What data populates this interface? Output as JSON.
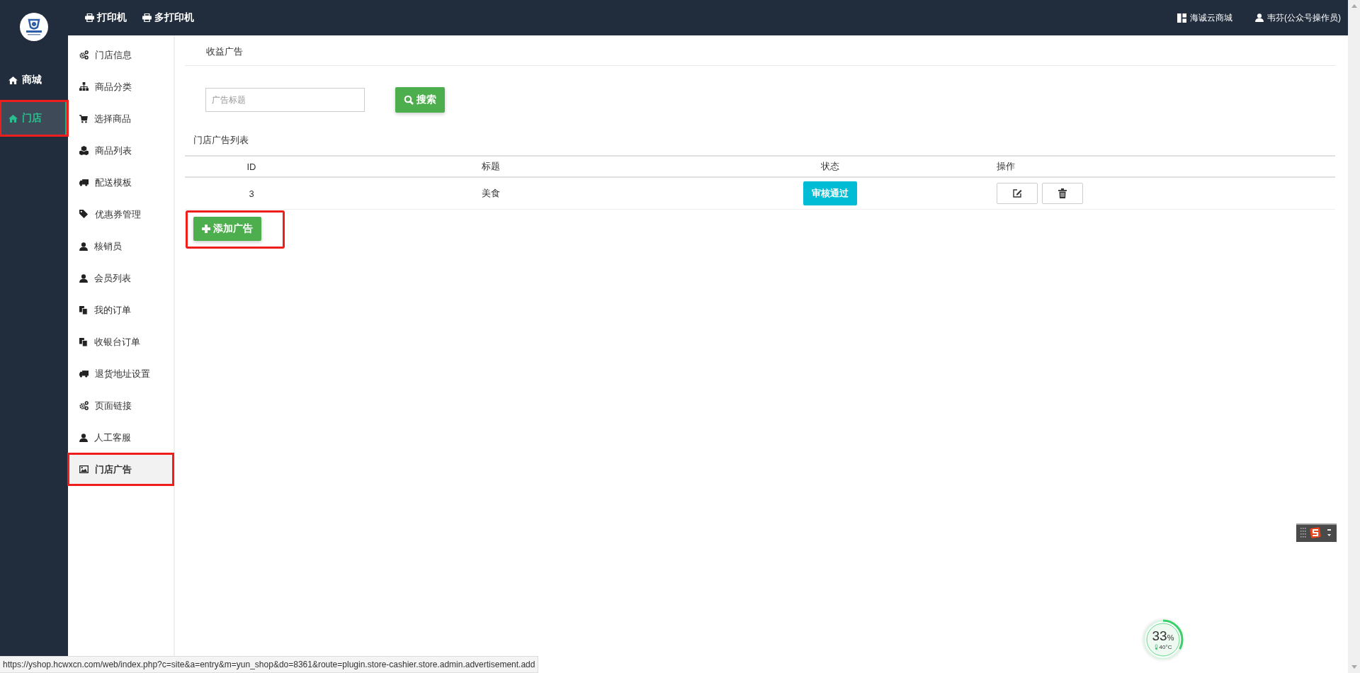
{
  "topbar": {
    "links": [
      {
        "kind": "printer",
        "label": "打印机"
      },
      {
        "kind": "printer",
        "label": "多打印机"
      }
    ],
    "right": [
      {
        "kind": "grid",
        "label": "海诚云商城"
      },
      {
        "kind": "user",
        "label": "韦芬(公众号操作员)"
      }
    ]
  },
  "rail": [
    {
      "label": "商城",
      "selected": false,
      "highlighted": false
    },
    {
      "label": "门店",
      "selected": true,
      "highlighted": true
    }
  ],
  "submenu": [
    {
      "kind": "gears",
      "label": "门店信息",
      "selected": false,
      "highlighted": false
    },
    {
      "kind": "sitemap",
      "label": "商品分类",
      "selected": false,
      "highlighted": false
    },
    {
      "kind": "cart",
      "label": "选择商品",
      "selected": false,
      "highlighted": false
    },
    {
      "kind": "cubes",
      "label": "商品列表",
      "selected": false,
      "highlighted": false
    },
    {
      "kind": "truck",
      "label": "配送模板",
      "selected": false,
      "highlighted": false
    },
    {
      "kind": "tags",
      "label": "优惠券管理",
      "selected": false,
      "highlighted": false
    },
    {
      "kind": "user",
      "label": "核销员",
      "selected": false,
      "highlighted": false
    },
    {
      "kind": "user",
      "label": "会员列表",
      "selected": false,
      "highlighted": false
    },
    {
      "kind": "copy",
      "label": "我的订单",
      "selected": false,
      "highlighted": false
    },
    {
      "kind": "copy",
      "label": "收银台订单",
      "selected": false,
      "highlighted": false
    },
    {
      "kind": "truck",
      "label": "退货地址设置",
      "selected": false,
      "highlighted": false
    },
    {
      "kind": "gears",
      "label": "页面链接",
      "selected": false,
      "highlighted": false
    },
    {
      "kind": "user",
      "label": "人工客服",
      "selected": false,
      "highlighted": false
    },
    {
      "kind": "image",
      "label": "门店广告",
      "selected": true,
      "highlighted": true
    }
  ],
  "content": {
    "title": "收益广告",
    "search": {
      "placeholder": "广告标题",
      "button": "搜索"
    },
    "list_title": "门店广告列表",
    "table": {
      "columns": [
        "ID",
        "标题",
        "状态",
        "操作"
      ],
      "rows": [
        {
          "id": "3",
          "title": "美食",
          "status": "审核通过"
        }
      ]
    },
    "add_button": {
      "label": "添加广告",
      "highlighted": true
    }
  },
  "monitor": {
    "percent": "33",
    "unit": "%",
    "temperature": "40°C",
    "level": 0.33
  },
  "status_bar": {
    "url": "https://yshop.hcwxcn.com/web/index.php?c=site&a=entry&m=yun_shop&do=8361&route=plugin.store-cashier.store.admin.advertisement.add"
  }
}
